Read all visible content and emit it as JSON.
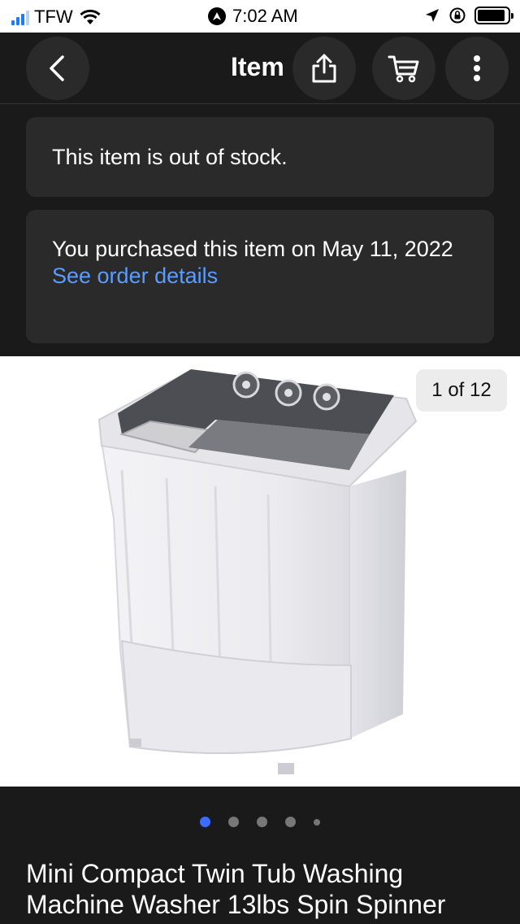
{
  "status_bar": {
    "carrier": "TFW",
    "time": "7:02 AM",
    "battery_level": 0.92
  },
  "nav": {
    "title": "Item",
    "icons": [
      "back-icon",
      "share-icon",
      "cart-icon",
      "more-icon"
    ]
  },
  "notices": {
    "out_of_stock": "This item is out of stock.",
    "purchase_text": "You purchased this item on May 11, 2022",
    "order_link": "See order details"
  },
  "gallery": {
    "counter": "1 of 12",
    "total_dots": 5,
    "active_dot": 0
  },
  "product": {
    "title": "Mini Compact Twin Tub Washing Machine Washer 13lbs Spin Spinner"
  },
  "colors": {
    "background": "#1a1a1a",
    "card": "#2a2a2a",
    "link": "#5b9cff",
    "active_dot": "#3b6cff"
  }
}
